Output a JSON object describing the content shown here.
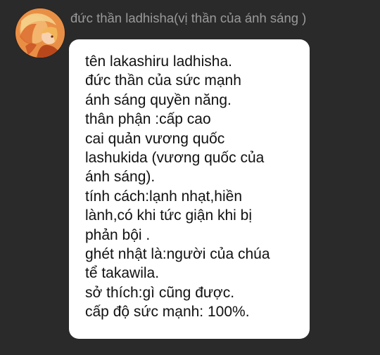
{
  "sender": {
    "name": "đức thần ladhisha(vị thần của ánh sáng )",
    "avatar_icon": "character-avatar"
  },
  "message": {
    "lines": [
      "tên lakashiru ladhisha.",
      "đức thần của sức mạnh",
      "ánh sáng quyền năng.",
      "thân phận :cấp cao",
      "cai quản vương quốc",
      "lashukida (vương quốc của",
      "ánh sáng).",
      "tính cách:lạnh nhạt,hiền",
      "lành,có khi tức giận khi bị",
      "phản bội .",
      "ghét nhật là:người của chúa",
      "tể takawila.",
      "sở thích:gì cũng được.",
      "cấp độ sức mạnh: 100%."
    ]
  },
  "colors": {
    "background": "#2a2a2a",
    "bubble": "#ffffff",
    "name_text": "#9a9a9a",
    "message_text": "#111111"
  }
}
